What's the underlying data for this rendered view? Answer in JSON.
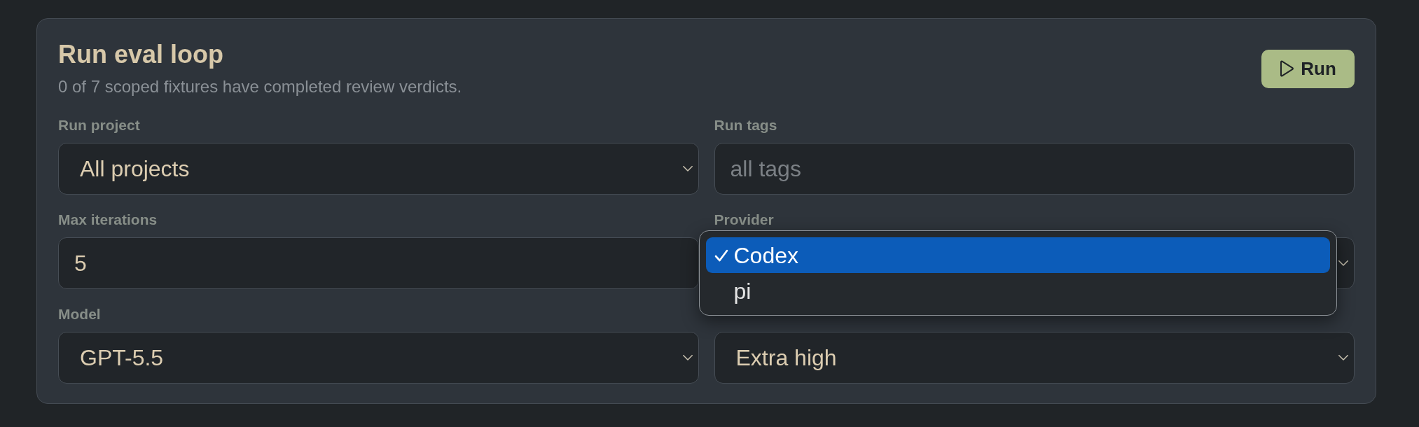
{
  "card": {
    "title": "Run eval loop",
    "subtitle": "0 of 7 scoped fixtures have completed review verdicts.",
    "run_button": {
      "label": "Run"
    }
  },
  "fields": [
    {
      "kind": "select",
      "label": "Run project",
      "value": "All projects"
    },
    {
      "kind": "text",
      "label": "Run tags",
      "placeholder": "all tags"
    },
    {
      "kind": "text",
      "label": "Max iterations",
      "value": "5"
    },
    {
      "kind": "select",
      "label": "Provider",
      "menu": {
        "options": [
          {
            "label": "Codex",
            "selected": true
          },
          {
            "label": "pi",
            "selected": false
          }
        ]
      }
    },
    {
      "kind": "select",
      "label": "Model",
      "value": "GPT-5.5"
    },
    {
      "kind": "select",
      "value": "Extra high"
    }
  ]
}
